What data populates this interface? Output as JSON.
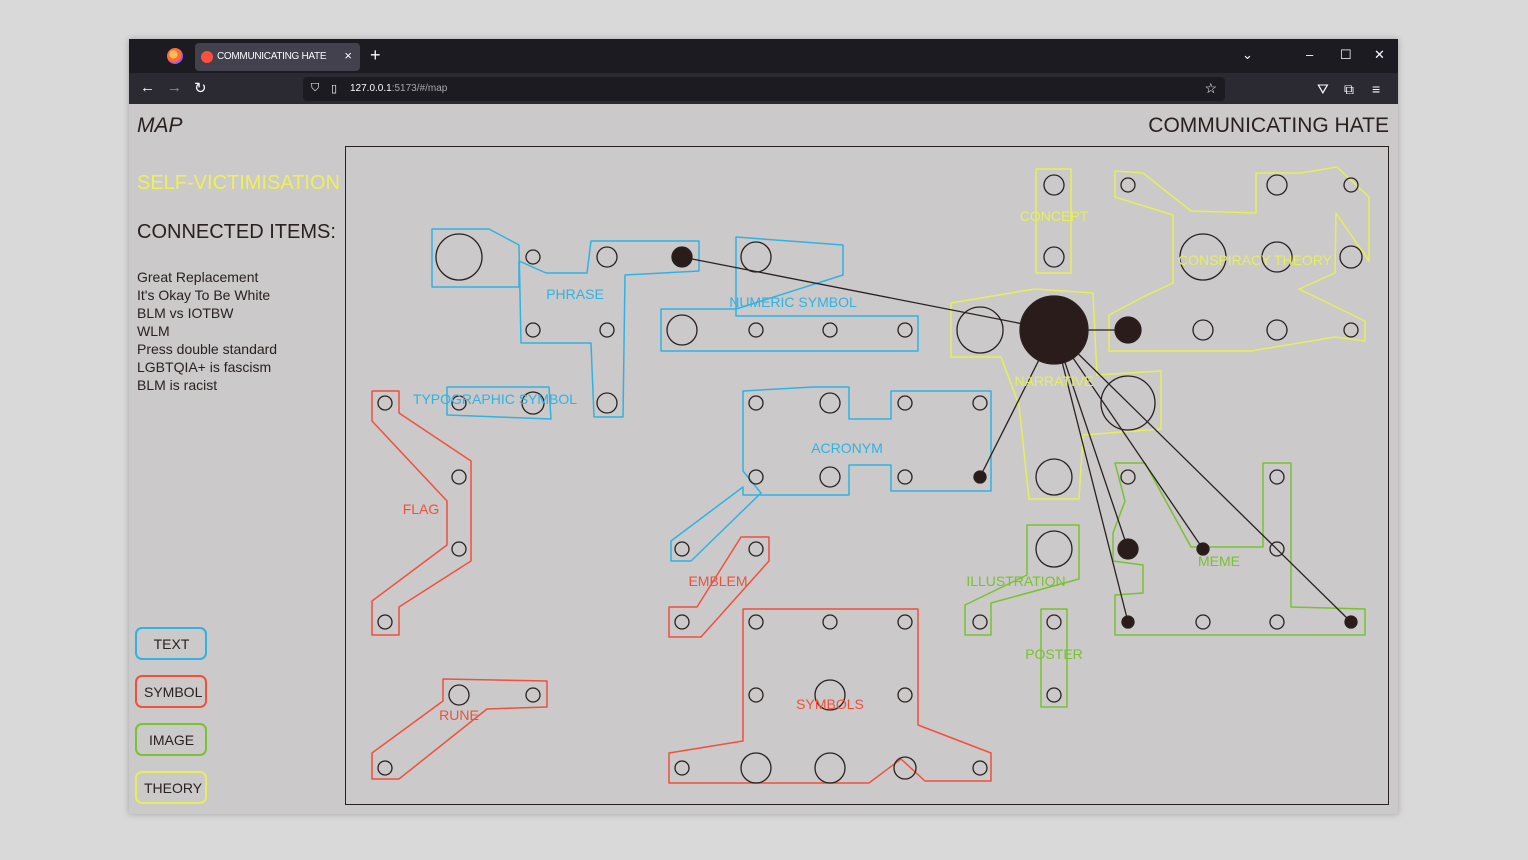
{
  "browser": {
    "tab_title": "COMMUNICATING HATE",
    "tab_close": "×",
    "new_tab": "+",
    "url_host": "127.0.0.1",
    "url_rest": ":5173/#/map"
  },
  "header": {
    "left_title": "MAP",
    "right_title": "COMMUNICATING HATE"
  },
  "sidebar": {
    "selected_item": "SELF-VICTIMISATION",
    "connected_heading": "CONNECTED ITEMS:",
    "connected_items": [
      "Great Replacement",
      "It's Okay To Be White",
      "BLM vs IOTBW",
      "WLM",
      "Press double standard",
      "LGBTQIA+ is fascism",
      "BLM is racist"
    ]
  },
  "legend": [
    {
      "label": "TEXT",
      "color": "#2fb3e3"
    },
    {
      "label": "SYMBOL",
      "color": "#f0513d"
    },
    {
      "label": "IMAGE",
      "color": "#79c230"
    },
    {
      "label": "THEORY",
      "color": "#e6ef5a"
    }
  ],
  "map": {
    "categories": {
      "text": "#2fb3e3",
      "symbol": "#f0513d",
      "image": "#79c230",
      "theory": "#e6ef5a"
    },
    "clusters": [
      {
        "label": "PHRASE",
        "cat": "text"
      },
      {
        "label": "NUMERIC SYMBOL",
        "cat": "text"
      },
      {
        "label": "TYPOGRAPHIC SYMBOL",
        "cat": "text"
      },
      {
        "label": "ACRONYM",
        "cat": "text"
      },
      {
        "label": "FLAG",
        "cat": "symbol"
      },
      {
        "label": "EMBLEM",
        "cat": "symbol"
      },
      {
        "label": "RUNE",
        "cat": "symbol"
      },
      {
        "label": "SYMBOLS",
        "cat": "symbol"
      },
      {
        "label": "CONCEPT",
        "cat": "theory"
      },
      {
        "label": "CONSPIRACY THEORY",
        "cat": "theory"
      },
      {
        "label": "NARRATIVE",
        "cat": "theory"
      },
      {
        "label": "ILLUSTRATION",
        "cat": "image"
      },
      {
        "label": "POSTER",
        "cat": "image"
      },
      {
        "label": "MEME",
        "cat": "image"
      }
    ]
  }
}
